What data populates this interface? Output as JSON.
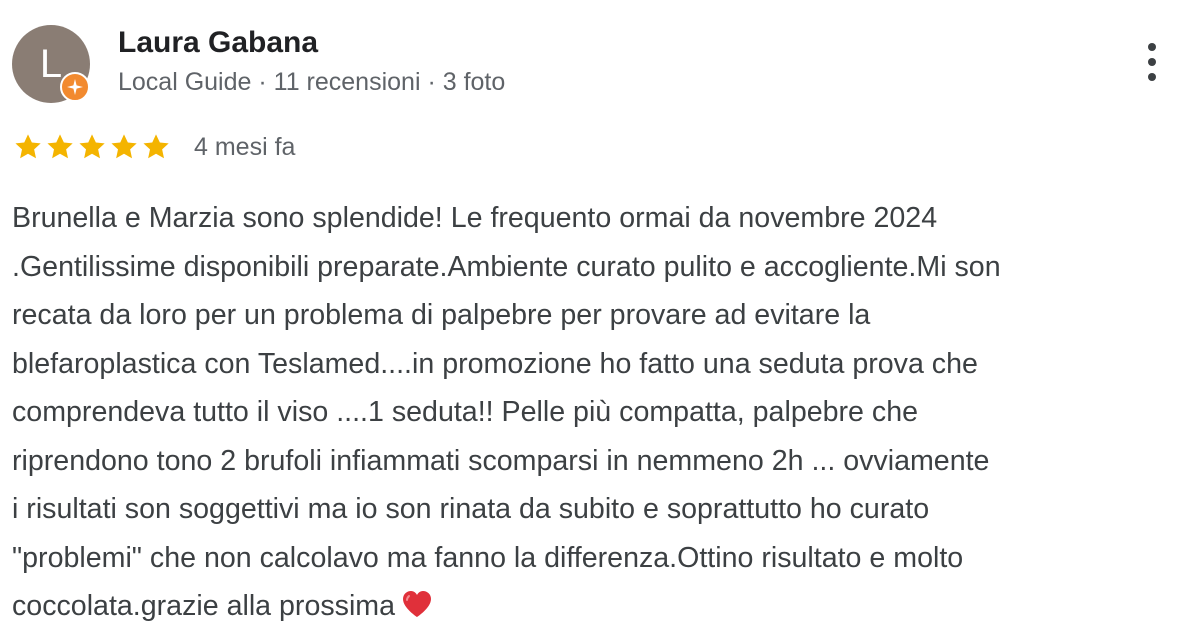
{
  "reviewer": {
    "avatar_letter": "L",
    "avatar_color": "#8a7d74",
    "name": "Laura Gabana",
    "badge_icon": "local-guide-icon",
    "badge_color": "#f28a2f",
    "meta": {
      "role": "Local Guide",
      "separator": " · ",
      "reviews": "11 recensioni",
      "photos": "3 foto"
    }
  },
  "menu": {
    "icon": "more-vert-icon"
  },
  "rating": {
    "stars": 5,
    "max_stars": 5,
    "star_color": "#f4b400",
    "time": "4 mesi fa"
  },
  "review": {
    "lines": [
      "Brunella e Marzia sono splendide! Le frequento ormai da novembre 2024",
      ".Gentilissime disponibili preparate.Ambiente curato pulito e accogliente.Mi son",
      "recata da loro per un problema di palpebre per provare ad evitare la",
      "blefaroplastica con Teslamed....in promozione ho fatto una seduta prova che",
      "comprendeva tutto il viso ....1 seduta!! Pelle più compatta, palpebre che",
      "riprendono tono 2 brufoli infiammati scomparsi in nemmeno 2h ... ovviamente",
      "i risultati son soggettivi ma io son rinata da subito e soprattutto ho curato",
      "\"problemi\" che non calcolavo ma fanno la differenza.Ottino risultato e molto",
      "coccolata.grazie alla prossima"
    ],
    "emoji_icon": "red-heart-icon",
    "emoji_color": "#e0303a"
  }
}
